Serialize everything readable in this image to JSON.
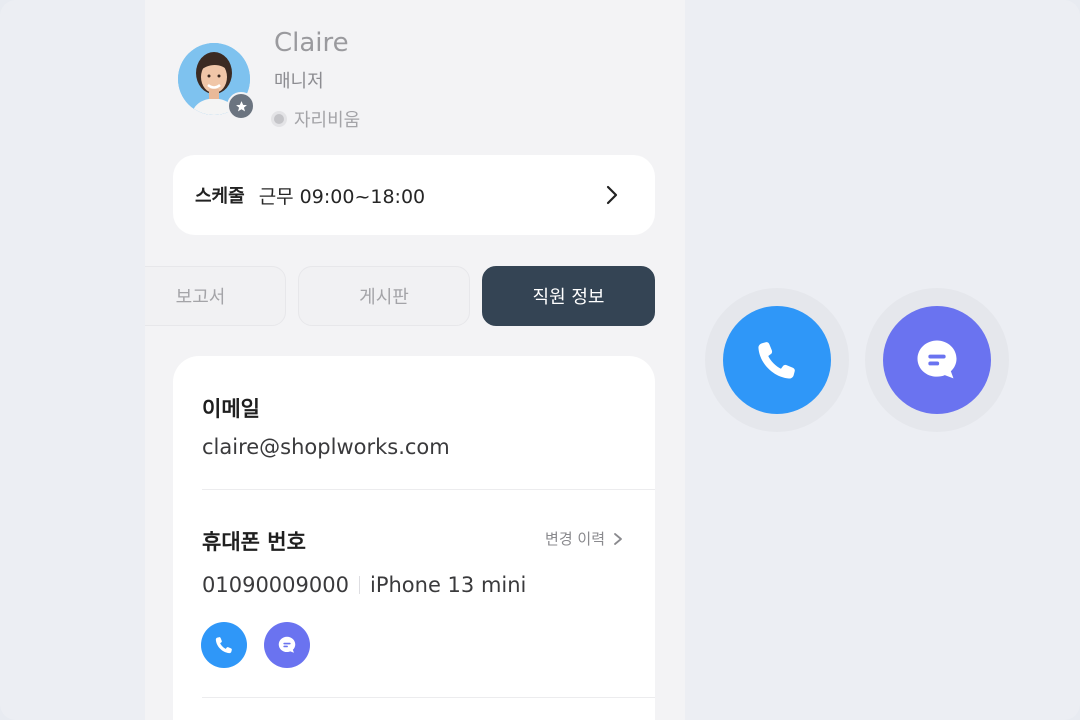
{
  "profile": {
    "name": "Claire",
    "role": "매니저",
    "status": "자리비움"
  },
  "schedule": {
    "label": "스케줄",
    "time": "근무 09:00~18:00"
  },
  "tabs": [
    {
      "label": "보고서",
      "active": false
    },
    {
      "label": "게시판",
      "active": false
    },
    {
      "label": "직원 정보",
      "active": true
    }
  ],
  "info": {
    "email_label": "이메일",
    "email_value": "claire@shoplworks.com",
    "phone_label": "휴대폰 번호",
    "history_label": "변경 이력",
    "phone_number": "01090009000",
    "device": "iPhone 13 mini"
  },
  "colors": {
    "call": "#2f97f8",
    "message": "#6a73f0",
    "active_tab": "#344454"
  },
  "icons": {
    "call": "phone-icon",
    "message": "chat-bubble-icon",
    "badge": "star-icon",
    "chevron": "chevron-right-icon"
  }
}
